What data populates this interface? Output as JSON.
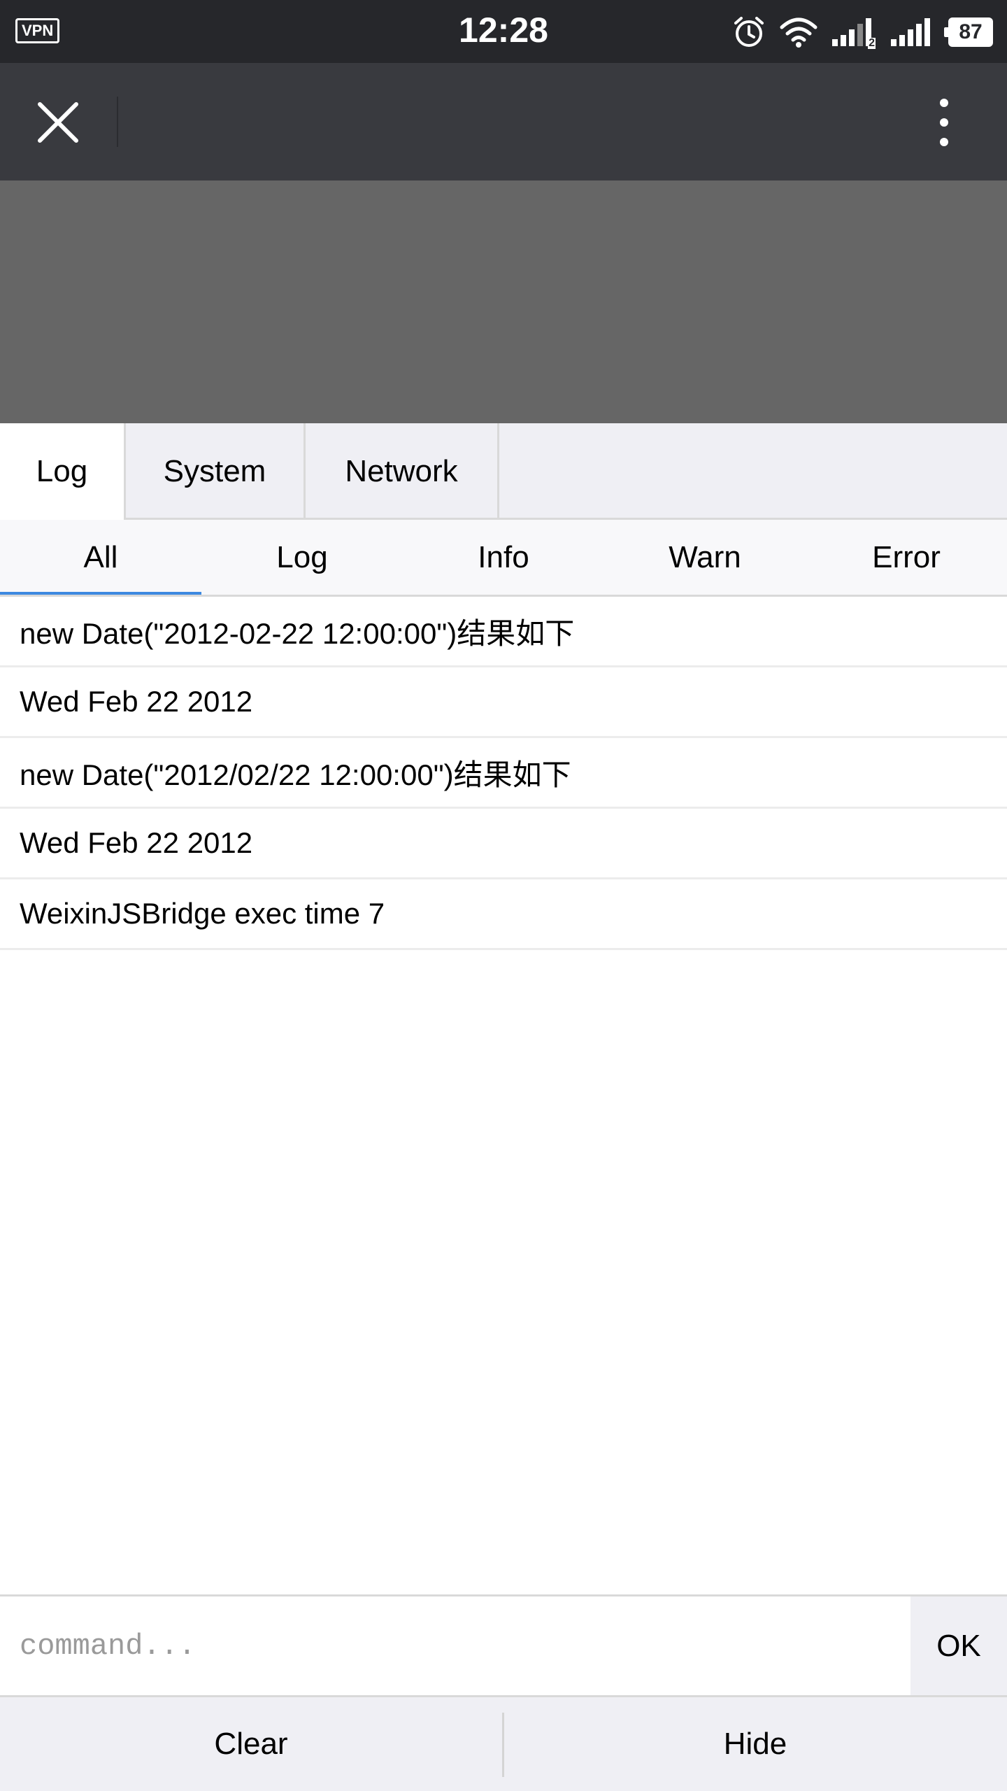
{
  "status_bar": {
    "vpn": "VPN",
    "time": "12:28",
    "signal_sim2_label": "2",
    "battery": "87",
    "icons": [
      "vpn-icon",
      "alarm-icon",
      "wifi-icon",
      "signal-icon",
      "signal-icon",
      "battery-icon"
    ]
  },
  "title_bar": {
    "close_icon": "close-icon",
    "more_icon": "more-vertical-icon"
  },
  "console": {
    "tabs": [
      {
        "label": "Log",
        "active": true
      },
      {
        "label": "System",
        "active": false
      },
      {
        "label": "Network",
        "active": false
      }
    ],
    "filters": [
      {
        "label": "All",
        "active": true
      },
      {
        "label": "Log",
        "active": false
      },
      {
        "label": "Info",
        "active": false
      },
      {
        "label": "Warn",
        "active": false
      },
      {
        "label": "Error",
        "active": false
      }
    ],
    "logs": [
      "new Date(\"2012-02-22 12:00:00\")结果如下",
      "Wed Feb 22 2012",
      "new Date(\"2012/02/22 12:00:00\")结果如下",
      "Wed Feb 22 2012",
      "WeixinJSBridge exec time 7"
    ],
    "command": {
      "placeholder": "command...",
      "value": "",
      "ok_label": "OK"
    },
    "actions": {
      "clear_label": "Clear",
      "hide_label": "Hide"
    }
  },
  "colors": {
    "status_bar": "#26272b",
    "title_bar": "#393a3f",
    "content_overlay": "#666666",
    "accent": "#3d89e0",
    "panel_bg": "#efeff4"
  }
}
